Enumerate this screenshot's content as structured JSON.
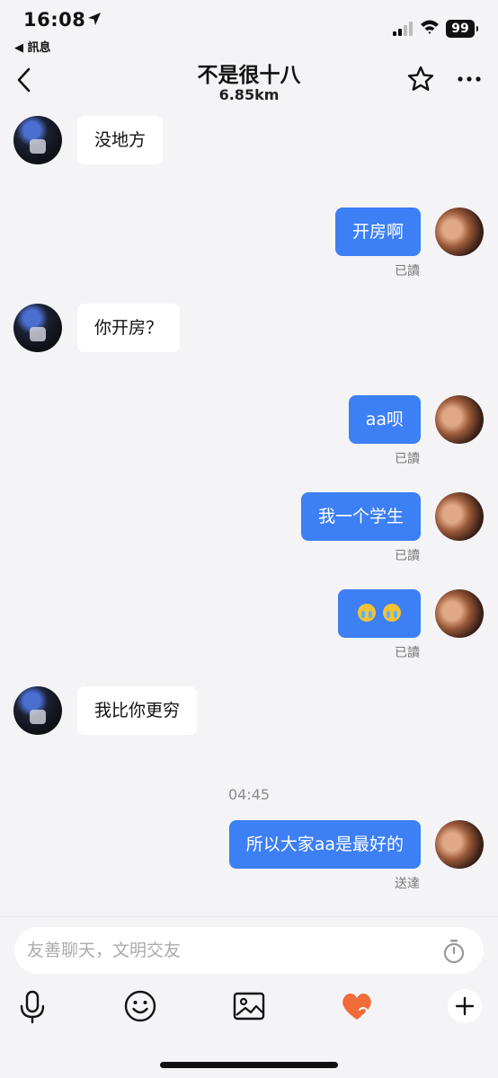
{
  "status_bar": {
    "time": "16:08",
    "back_app": "◀ 訊息",
    "battery": "99"
  },
  "header": {
    "title": "不是很十八",
    "distance": "6.85km"
  },
  "messages": [
    {
      "side": "peer",
      "text": "没地方"
    },
    {
      "side": "me",
      "text": "开房啊",
      "status": "已讀"
    },
    {
      "side": "peer",
      "text": "你开房？"
    },
    {
      "side": "me",
      "text": "aa呗",
      "status": "已讀"
    },
    {
      "side": "me",
      "text": "我一个学生",
      "status": "已讀"
    },
    {
      "side": "me",
      "text": "",
      "emoji": "crying-face x2",
      "status": "已讀"
    },
    {
      "side": "peer",
      "text": "我比你更穷"
    },
    {
      "side": "me",
      "text": "所以大家aa是最好的",
      "status": "送達"
    }
  ],
  "timestamp": "04:45",
  "composer": {
    "placeholder": "友善聊天，文明交友"
  },
  "toolbar": {
    "icons": [
      "microphone-icon",
      "smile-icon",
      "image-icon",
      "heart-icon",
      "plus-icon"
    ]
  },
  "colors": {
    "bubble_me": "#3d7ff5",
    "bubble_peer": "#ffffff",
    "background": "#f4f4f6",
    "heart": "#f26b3a"
  }
}
